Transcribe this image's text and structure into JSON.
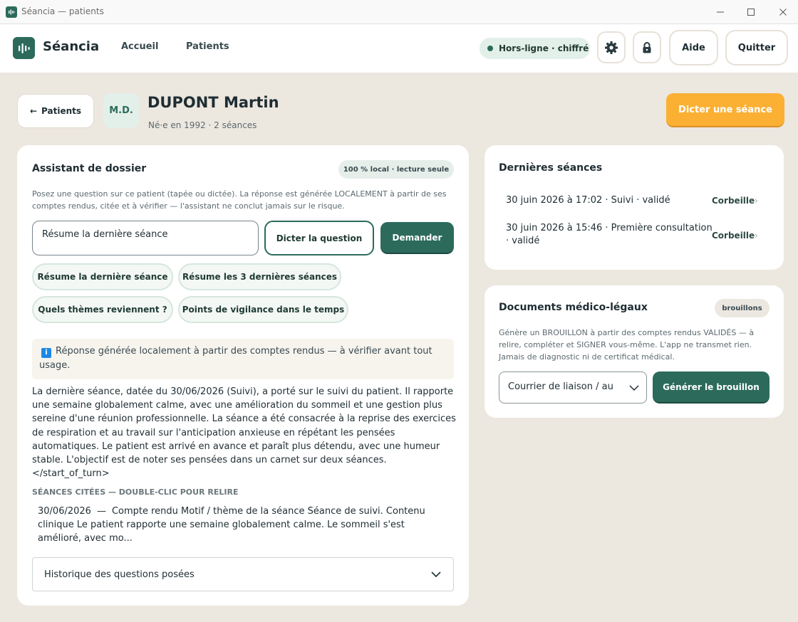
{
  "window": {
    "title": "Séancia — patients"
  },
  "nav": {
    "brand": "Séancia",
    "links": [
      "Accueil",
      "Patients"
    ],
    "status": "Hors-ligne · chiffré",
    "help": "Aide",
    "quit": "Quitter"
  },
  "patient": {
    "back": "Patients",
    "initials": "M.D.",
    "name": "DUPONT Martin",
    "subtitle": "Né·e en 1992 · 2 séances",
    "dictate": "Dicter une séance"
  },
  "assistant": {
    "title": "Assistant de dossier",
    "badge": "100 % local · lecture seule",
    "hint_line1": "Posez une question sur ce patient (tapée ou dictée). La réponse est générée LOCALEMENT à partir de ses",
    "hint_line2": "comptes rendus, citée et à vérifier — l'assistant ne conclut jamais sur le risque.",
    "input_value": "Résume la dernière séance",
    "dictate_question": "Dicter la question",
    "ask": "Demander",
    "chips": [
      "Résume la dernière séance",
      "Résume les 3 dernières séances",
      "Quels thèmes reviennent ?",
      "Points de vigilance dans le temps"
    ],
    "info": "Réponse générée localement à partir des comptes rendus — à vérifier avant tout usage.",
    "answer": "La dernière séance, datée du 30/06/2026 (Suivi), a porté sur le suivi du patient. Il rapporte une semaine globalement calme, avec une amélioration du sommeil et une gestion plus sereine d'une réunion professionnelle. La séance a été consacrée à la reprise des exercices de respiration et au travail sur l'anticipation anxieuse en répétant les pensées automatiques. Le patient est arrivé en avance et paraît plus détendu, avec une humeur stable. L'objectif est de noter ses pensées dans un carnet sur deux séances.",
    "answer_tail": "</start_of_turn>",
    "cited_label": "SÉANCES CITÉES — DOUBLE-CLIC POUR RELIRE",
    "cited_date": "30/06/2026",
    "cited_dash": "—",
    "cited_text": "Compte rendu Motif / thème de la séance Séance de suivi.  Contenu clinique Le patient rapporte une semaine globalement calme. Le sommeil s'est amélioré, avec mo...",
    "history": "Historique des questions posées"
  },
  "sessions": {
    "title": "Dernières séances",
    "items": [
      {
        "text": "30 juin 2026 à 17:02 · Suivi · validé",
        "action": "Corbeille"
      },
      {
        "text": "30 juin 2026 à 15:46 · Première consultation · validé",
        "action": "Corbeille"
      }
    ],
    "chevron": "›"
  },
  "documents": {
    "title": "Documents médico-légaux",
    "badge": "brouillons",
    "hint_line1": "Génère un BROUILLON à partir des comptes rendus VALIDÉS — à",
    "hint_line2": "relire, compléter et SIGNER vous-même. L'app ne transmet rien.",
    "hint_line3": "Jamais de diagnostic ni de certificat médical.",
    "select_value": "Courrier de liaison / au",
    "generate": "Générer le brouillon"
  },
  "colors": {
    "primary": "#2c6b5c",
    "accent": "#fbb034",
    "background": "#ece7df"
  }
}
